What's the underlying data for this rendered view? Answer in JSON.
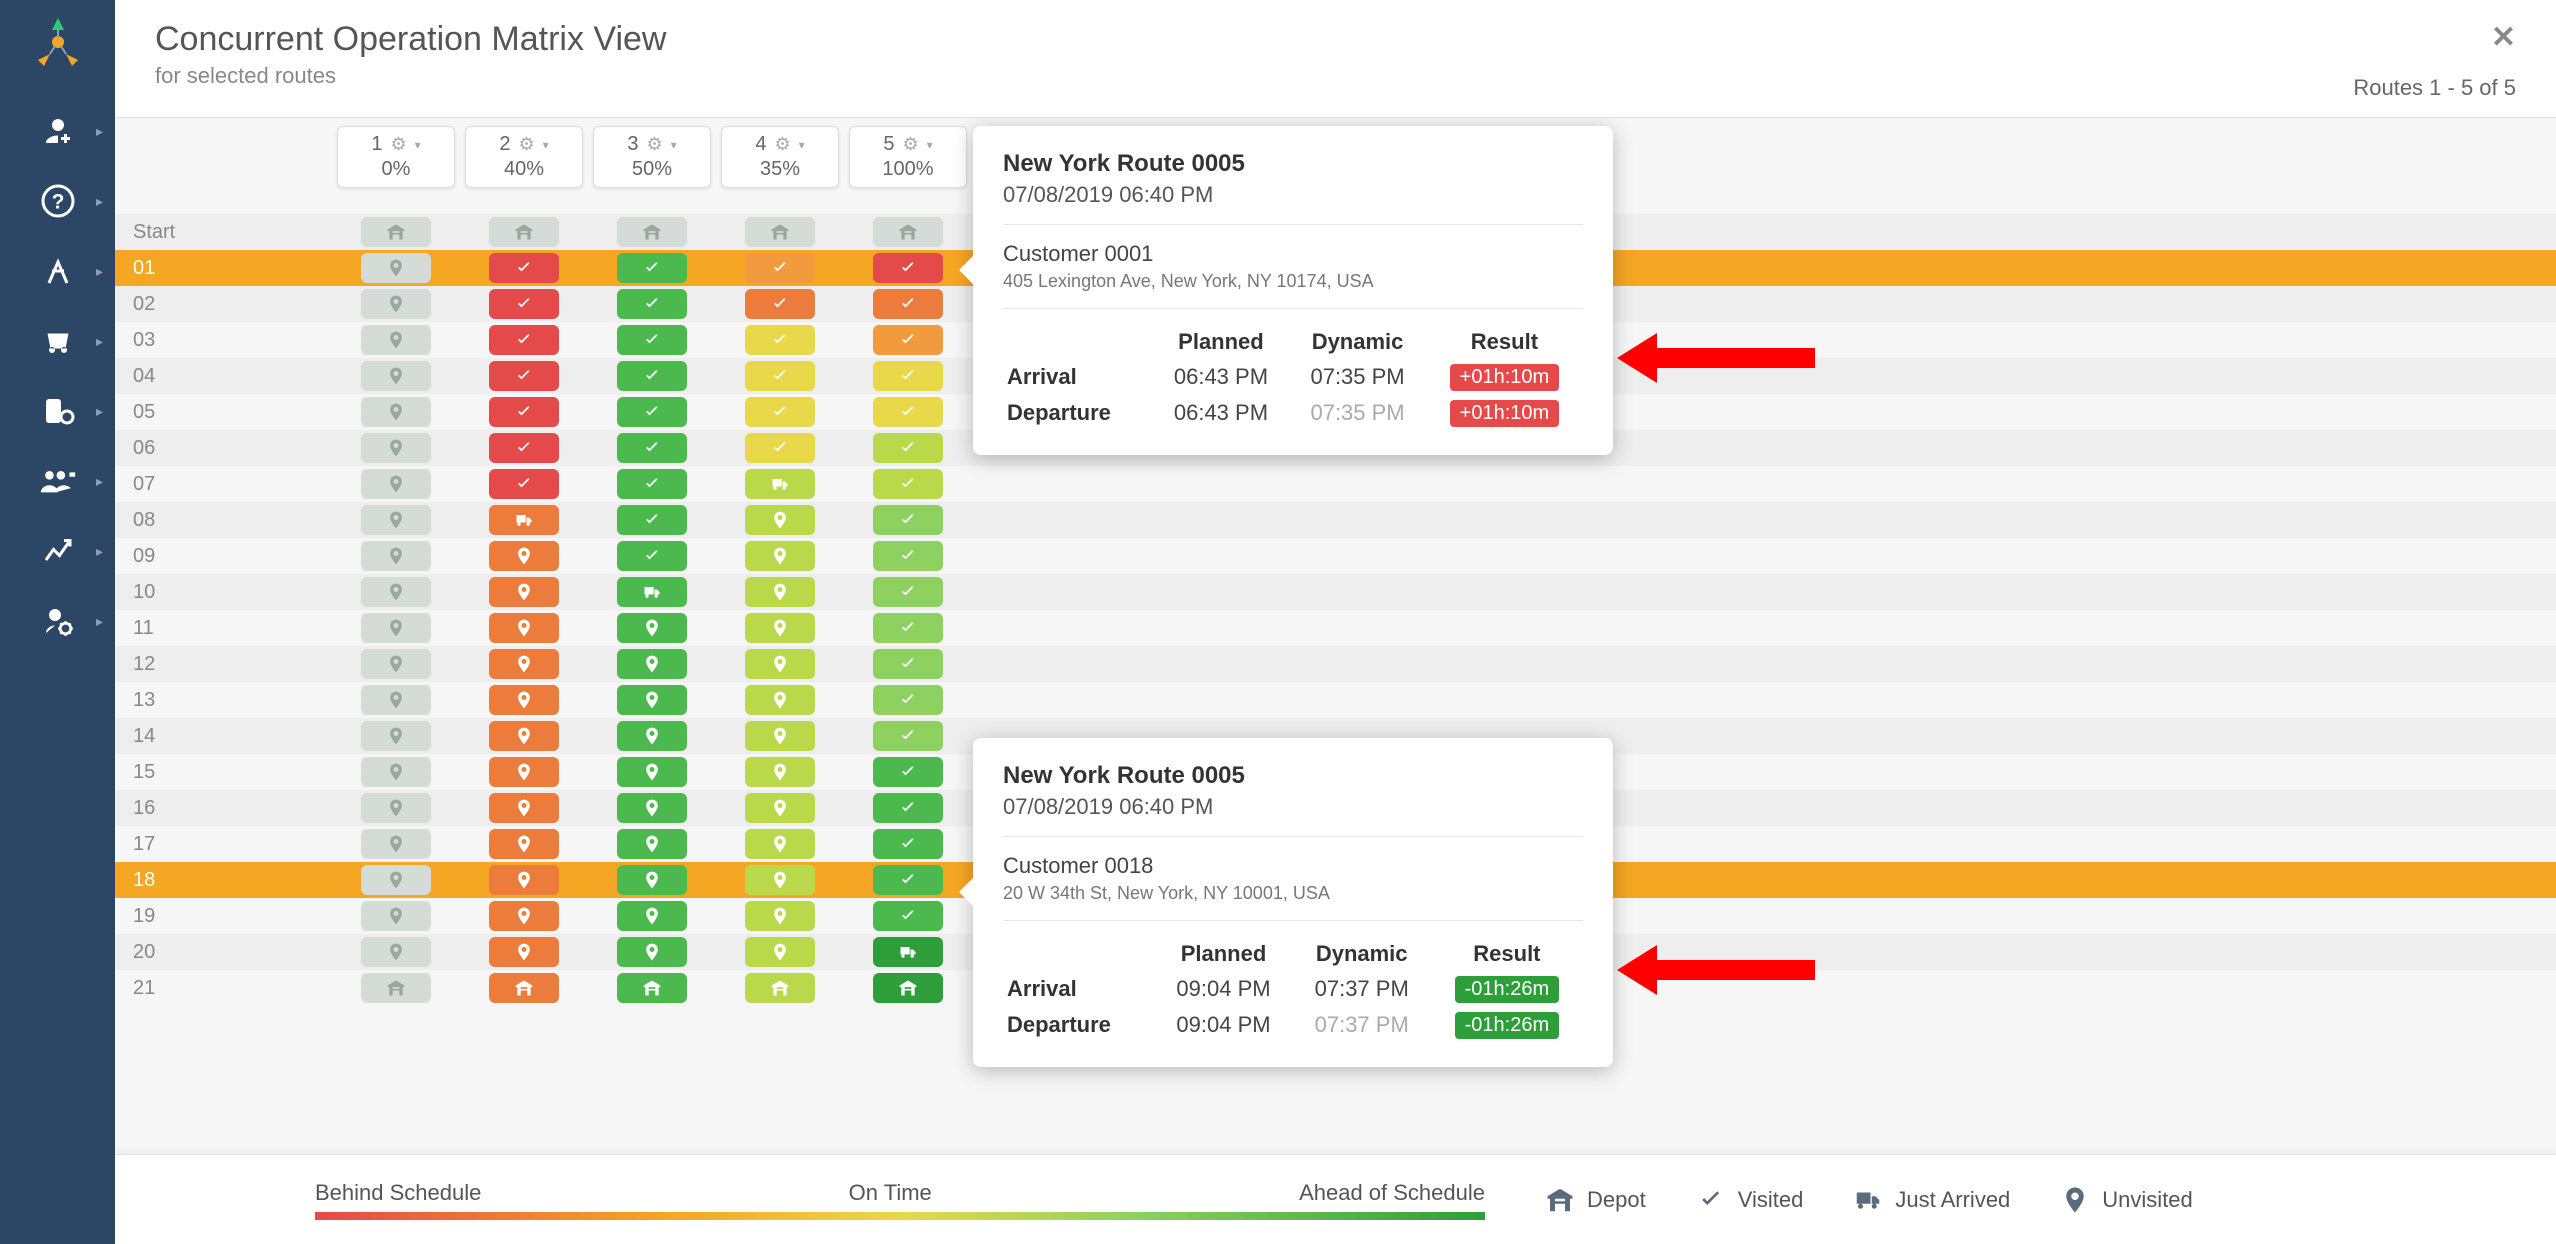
{
  "header": {
    "title": "Concurrent Operation Matrix View",
    "subtitle": "for selected routes",
    "route_count": "Routes 1 - 5 of 5"
  },
  "columns": [
    {
      "num": "1",
      "pct": "0%"
    },
    {
      "num": "2",
      "pct": "40%"
    },
    {
      "num": "3",
      "pct": "50%"
    },
    {
      "num": "4",
      "pct": "35%"
    },
    {
      "num": "5",
      "pct": "100%"
    }
  ],
  "row_labels": [
    "Start",
    "01",
    "02",
    "03",
    "04",
    "05",
    "06",
    "07",
    "08",
    "09",
    "10",
    "11",
    "12",
    "13",
    "14",
    "15",
    "16",
    "17",
    "18",
    "19",
    "20",
    "21"
  ],
  "highlight_rows": [
    1,
    18
  ],
  "matrix": [
    [
      {
        "c": "gray",
        "i": "depot"
      },
      {
        "c": "gray",
        "i": "depot"
      },
      {
        "c": "gray",
        "i": "depot"
      },
      {
        "c": "gray",
        "i": "depot"
      },
      {
        "c": "gray",
        "i": "depot"
      }
    ],
    [
      {
        "c": "gray",
        "i": "pin"
      },
      {
        "c": "red",
        "i": "check"
      },
      {
        "c": "green",
        "i": "check"
      },
      {
        "c": "orange",
        "i": "check"
      },
      {
        "c": "red",
        "i": "check"
      }
    ],
    [
      {
        "c": "gray",
        "i": "pin"
      },
      {
        "c": "red",
        "i": "check"
      },
      {
        "c": "green",
        "i": "check"
      },
      {
        "c": "dorange",
        "i": "check"
      },
      {
        "c": "dorange",
        "i": "check"
      }
    ],
    [
      {
        "c": "gray",
        "i": "pin"
      },
      {
        "c": "red",
        "i": "check"
      },
      {
        "c": "green",
        "i": "check"
      },
      {
        "c": "yellow",
        "i": "check"
      },
      {
        "c": "orange",
        "i": "check"
      }
    ],
    [
      {
        "c": "gray",
        "i": "pin"
      },
      {
        "c": "red",
        "i": "check"
      },
      {
        "c": "green",
        "i": "check"
      },
      {
        "c": "yellow",
        "i": "check"
      },
      {
        "c": "yellow",
        "i": "check"
      }
    ],
    [
      {
        "c": "gray",
        "i": "pin"
      },
      {
        "c": "red",
        "i": "check"
      },
      {
        "c": "green",
        "i": "check"
      },
      {
        "c": "yellow",
        "i": "check"
      },
      {
        "c": "yellow",
        "i": "check"
      }
    ],
    [
      {
        "c": "gray",
        "i": "pin"
      },
      {
        "c": "red",
        "i": "check"
      },
      {
        "c": "green",
        "i": "check"
      },
      {
        "c": "yellow",
        "i": "check"
      },
      {
        "c": "lime",
        "i": "check"
      }
    ],
    [
      {
        "c": "gray",
        "i": "pin"
      },
      {
        "c": "red",
        "i": "check"
      },
      {
        "c": "green",
        "i": "check"
      },
      {
        "c": "lime",
        "i": "truck"
      },
      {
        "c": "lime",
        "i": "check"
      }
    ],
    [
      {
        "c": "gray",
        "i": "pin"
      },
      {
        "c": "dorange",
        "i": "truck"
      },
      {
        "c": "green",
        "i": "check"
      },
      {
        "c": "lime",
        "i": "pin"
      },
      {
        "c": "lgreen",
        "i": "check"
      }
    ],
    [
      {
        "c": "gray",
        "i": "pin"
      },
      {
        "c": "dorange",
        "i": "pin"
      },
      {
        "c": "green",
        "i": "check"
      },
      {
        "c": "lime",
        "i": "pin"
      },
      {
        "c": "lgreen",
        "i": "check"
      }
    ],
    [
      {
        "c": "gray",
        "i": "pin"
      },
      {
        "c": "dorange",
        "i": "pin"
      },
      {
        "c": "green",
        "i": "truck"
      },
      {
        "c": "lime",
        "i": "pin"
      },
      {
        "c": "lgreen",
        "i": "check"
      }
    ],
    [
      {
        "c": "gray",
        "i": "pin"
      },
      {
        "c": "dorange",
        "i": "pin"
      },
      {
        "c": "green",
        "i": "pin"
      },
      {
        "c": "lime",
        "i": "pin"
      },
      {
        "c": "lgreen",
        "i": "check"
      }
    ],
    [
      {
        "c": "gray",
        "i": "pin"
      },
      {
        "c": "dorange",
        "i": "pin"
      },
      {
        "c": "green",
        "i": "pin"
      },
      {
        "c": "lime",
        "i": "pin"
      },
      {
        "c": "lgreen",
        "i": "check"
      }
    ],
    [
      {
        "c": "gray",
        "i": "pin"
      },
      {
        "c": "dorange",
        "i": "pin"
      },
      {
        "c": "green",
        "i": "pin"
      },
      {
        "c": "lime",
        "i": "pin"
      },
      {
        "c": "lgreen",
        "i": "check"
      }
    ],
    [
      {
        "c": "gray",
        "i": "pin"
      },
      {
        "c": "dorange",
        "i": "pin"
      },
      {
        "c": "green",
        "i": "pin"
      },
      {
        "c": "lime",
        "i": "pin"
      },
      {
        "c": "lgreen",
        "i": "check"
      }
    ],
    [
      {
        "c": "gray",
        "i": "pin"
      },
      {
        "c": "dorange",
        "i": "pin"
      },
      {
        "c": "green",
        "i": "pin"
      },
      {
        "c": "lime",
        "i": "pin"
      },
      {
        "c": "green",
        "i": "check"
      }
    ],
    [
      {
        "c": "gray",
        "i": "pin"
      },
      {
        "c": "dorange",
        "i": "pin"
      },
      {
        "c": "green",
        "i": "pin"
      },
      {
        "c": "lime",
        "i": "pin"
      },
      {
        "c": "green",
        "i": "check"
      }
    ],
    [
      {
        "c": "gray",
        "i": "pin"
      },
      {
        "c": "dorange",
        "i": "pin"
      },
      {
        "c": "green",
        "i": "pin"
      },
      {
        "c": "lime",
        "i": "pin"
      },
      {
        "c": "green",
        "i": "check"
      }
    ],
    [
      {
        "c": "gray",
        "i": "pin"
      },
      {
        "c": "dorange",
        "i": "pin"
      },
      {
        "c": "green",
        "i": "pin"
      },
      {
        "c": "lime",
        "i": "pin"
      },
      {
        "c": "green",
        "i": "check"
      }
    ],
    [
      {
        "c": "gray",
        "i": "pin"
      },
      {
        "c": "dorange",
        "i": "pin"
      },
      {
        "c": "green",
        "i": "pin"
      },
      {
        "c": "lime",
        "i": "pin"
      },
      {
        "c": "green",
        "i": "check"
      }
    ],
    [
      {
        "c": "gray",
        "i": "pin"
      },
      {
        "c": "dorange",
        "i": "pin"
      },
      {
        "c": "green",
        "i": "pin"
      },
      {
        "c": "lime",
        "i": "pin"
      },
      {
        "c": "dgreen",
        "i": "truck"
      }
    ],
    [
      {
        "c": "gray",
        "i": "depot"
      },
      {
        "c": "dorange",
        "i": "depot"
      },
      {
        "c": "green",
        "i": "depot"
      },
      {
        "c": "lime",
        "i": "depot"
      },
      {
        "c": "dgreen",
        "i": "depot"
      }
    ]
  ],
  "tooltip1": {
    "title": "New York Route 0005",
    "datetime": "07/08/2019 06:40 PM",
    "customer": "Customer 0001",
    "address": "405 Lexington Ave, New York, NY 10174, USA",
    "th_planned": "Planned",
    "th_dynamic": "Dynamic",
    "th_result": "Result",
    "arrival_label": "Arrival",
    "departure_label": "Departure",
    "arr_planned": "06:43 PM",
    "arr_dynamic": "07:35 PM",
    "arr_result": "+01h:10m",
    "dep_planned": "06:43 PM",
    "dep_dynamic": "07:35 PM",
    "dep_result": "+01h:10m"
  },
  "tooltip2": {
    "title": "New York Route 0005",
    "datetime": "07/08/2019 06:40 PM",
    "customer": "Customer 0018",
    "address": "20 W 34th St, New York, NY 10001, USA",
    "th_planned": "Planned",
    "th_dynamic": "Dynamic",
    "th_result": "Result",
    "arrival_label": "Arrival",
    "departure_label": "Departure",
    "arr_planned": "09:04 PM",
    "arr_dynamic": "07:37 PM",
    "arr_result": "-01h:26m",
    "dep_planned": "09:04 PM",
    "dep_dynamic": "07:37 PM",
    "dep_result": "-01h:26m"
  },
  "legend": {
    "behind": "Behind Schedule",
    "ontime": "On Time",
    "ahead": "Ahead of Schedule",
    "depot": "Depot",
    "visited": "Visited",
    "arrived": "Just Arrived",
    "unvisited": "Unvisited"
  }
}
